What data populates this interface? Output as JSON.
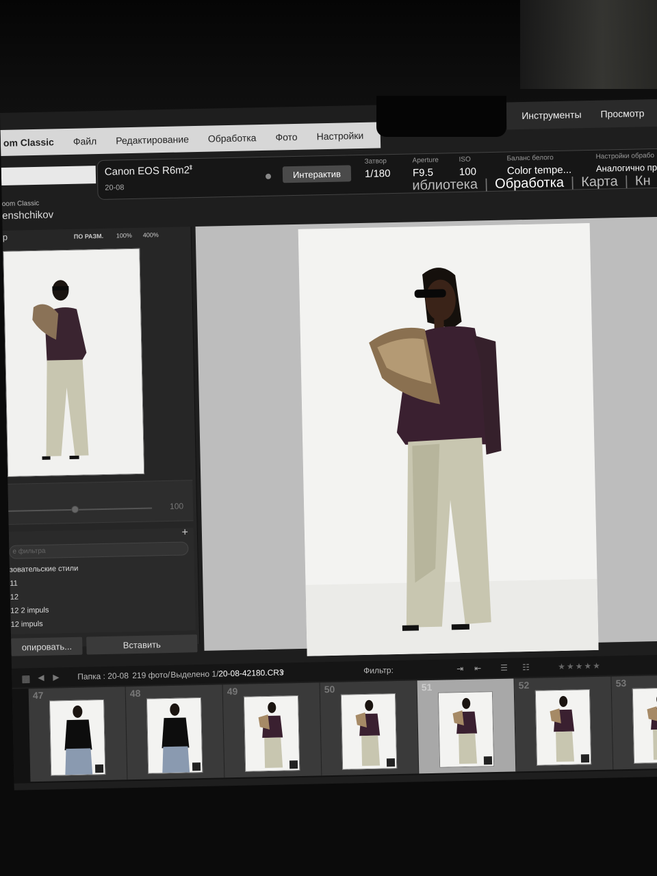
{
  "menu": {
    "app_name": "om Classic",
    "items": [
      "Файл",
      "Редактирование",
      "Обработка",
      "Фото",
      "Настройки"
    ]
  },
  "toolbar_right": [
    "Инструменты",
    "Просмотр"
  ],
  "camera": {
    "name": "Canon EOS R6m2",
    "date": "20-08",
    "live_button": "Интерактив",
    "shutter_label": "Затвор",
    "shutter_value": "1/180",
    "aperture_label": "Aperture",
    "aperture_value": "F9.5",
    "iso_label": "ISO",
    "iso_value": "100",
    "wb_label": "Баланс белого",
    "wb_value": "Color tempe...",
    "dev_label": "Настройки обрабо",
    "dev_value": "Аналогично пре"
  },
  "catalog": {
    "subtitle": "oom Classic",
    "user": "enshchikov"
  },
  "modules": [
    "иблиотека",
    "Обработка",
    "Карта",
    "Кн"
  ],
  "navigator": {
    "title": "р",
    "zoom_fit": "ПО РАЗМ.",
    "zoom_100": "100%",
    "zoom_400": "400%"
  },
  "slider": {
    "value": "100"
  },
  "presets": {
    "search_placeholder": "е фильтра",
    "items": [
      "зовательские стили",
      "11",
      "12",
      "12  2 impuls",
      "12 impuls"
    ]
  },
  "buttons": {
    "copy": "опировать...",
    "paste": "Вставить"
  },
  "filmstrip_bar": {
    "folder": "Папка : 20-08",
    "count": "219 фото/",
    "selected": "Выделено 1/",
    "filename": "20-08-42180.CR3",
    "filter_label": "Фильтр:",
    "stars": "★★★★★"
  },
  "filmstrip": {
    "numbers": [
      "47",
      "48",
      "49",
      "50",
      "51",
      "52",
      "53"
    ],
    "selected_index": 4
  }
}
